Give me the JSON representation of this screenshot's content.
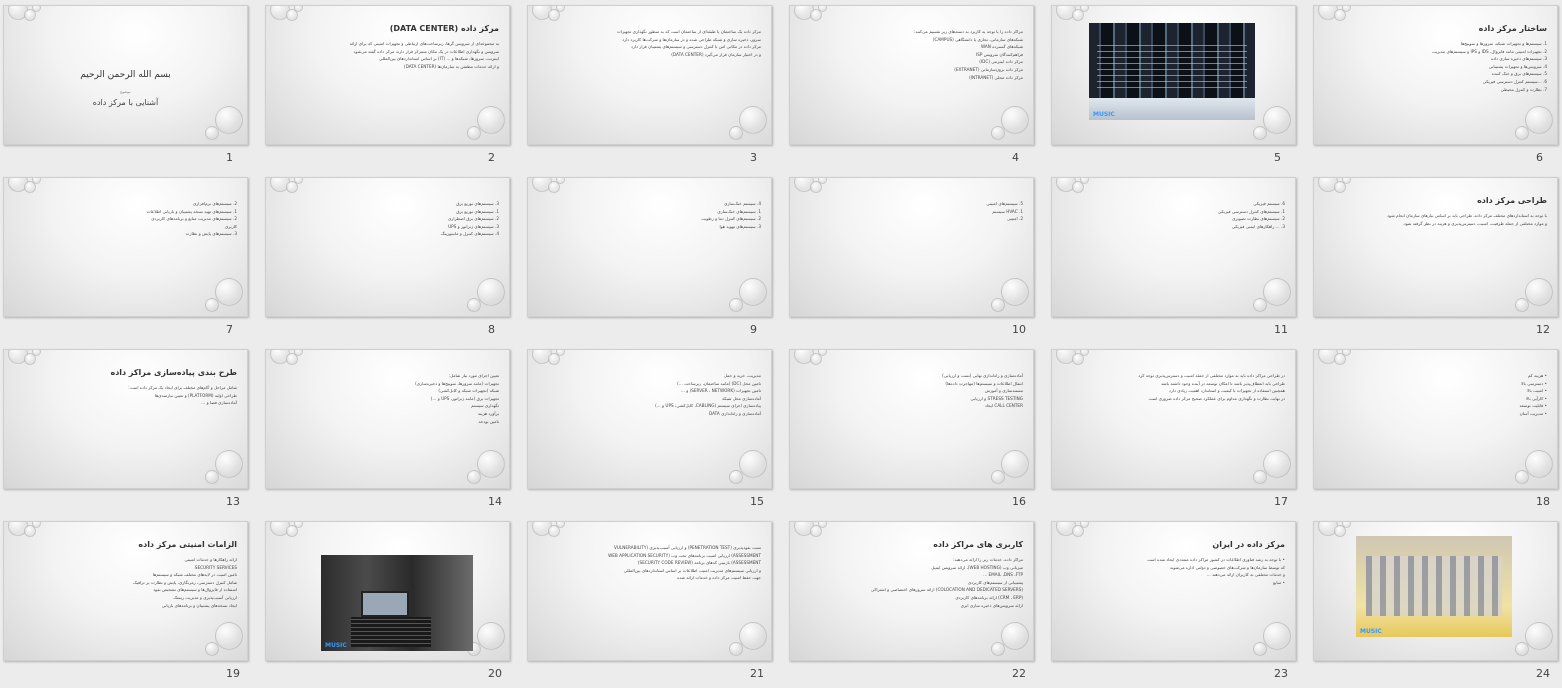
{
  "slides": [
    {
      "num": "1",
      "type": "title",
      "title": "بسم الله الرحمن الرحیم",
      "subtitle": "موضوع",
      "name": "آشنایی با مرکز داده"
    },
    {
      "num": "2",
      "type": "text",
      "title": "مرکز داده (DATA CENTER)",
      "lines": [
        "به مجموعه‌ای از سرویس گرها، زیرساخت‌های ارتباطی و تجهیزات امنیتی که برای ارائه",
        "سرویس و نگهداری اطلاعات در یک مکان متمرکز قرار دارند مرکز داده گفته می‌شود",
        "اینترنت، سرورها، شبکه‌ها و ... (IT) بر اساس استانداردهای بین‌المللی",
        "و ارائه خدمات مطمئن به سازمان‌ها (DATA CENTER)"
      ]
    },
    {
      "num": "3",
      "type": "text",
      "title": "",
      "lines": [
        "مرکز داده یک ساختمان یا طبقه‌ای از ساختمان است که به منظور نگهداری تجهیزات",
        "سرور، ذخیره سازی و شبکه طراحی شده و در سازمان‌ها و شرکت‌ها کاربرد دارد",
        "مرکز داده در مکانی امن با کنترل دسترسی و سیستم‌های پشتیبان قرار دارد",
        "و در اختیار سازمان قرار می‌گیرد (DATA CENTER)"
      ]
    },
    {
      "num": "4",
      "type": "text",
      "title": "",
      "lines": [
        "مراکز داده را با توجه به کاربرد به دسته‌های زیر تقسیم می‌کنند:",
        "شبکه‌های سازمانی، تجاری یا دانشگاهی (CAMPUS)",
        "شبکه‌های گسترده WAN",
        "فراهم‌کنندگان سرویس ISP",
        "مرکز داده اینترنتی (IDC)",
        "مرکز داده برون‌سازمانی (EXTRANET)",
        "مرکز داده محلی (INTRANET)"
      ]
    },
    {
      "num": "5",
      "type": "photo",
      "kind": "servers",
      "logo": "MUSIC"
    },
    {
      "num": "6",
      "type": "text",
      "title": "ساختار مرکز داده",
      "lines": [
        "1. سیستم‌ها و تجهیزات شبکه، سرورها و سوییچ‌ها",
        "2. تجهیزات امنیتی مانند فایروال، IDS و IPS و سیستم‌های مدیریت",
        "3. سیستم‌های ذخیره سازی داده",
        "4. سرویس‌ها و تجهیزات پشتیبانی",
        "5. سیستم‌های برق و خنک کننده",
        "6. ...سیستم کنترل دسترسی فیزیکی",
        "7. نظارت و کنترل محیطی"
      ]
    },
    {
      "num": "7",
      "type": "text",
      "title": "",
      "lines": [
        "2. سیستم‌های نرم‌افزاری",
        "1. سیستم‌های تهیه نسخه پشتیبان و بازیابی اطلاعات",
        "2. سیستم‌های مدیریت منابع و برنامه‌های کاربردی",
        "کاربری",
        "3. سیستم‌های پایش و نظارت"
      ]
    },
    {
      "num": "8",
      "type": "text",
      "title": "",
      "lines": [
        "3. سیستم‌های توزیع برق",
        "1. سیستم‌های توزیع برق",
        "2. سیستم‌های برق اضطراری",
        "3. سیستم‌های ژنراتور و UPS",
        "4. سیستم‌های کنترل و مانیتورینگ"
      ]
    },
    {
      "num": "9",
      "type": "text",
      "title": "",
      "lines": [
        "4. سیستم خنک‌سازی",
        "1. سیستم‌های خنک‌سازی",
        "2. سیستم‌های کنترل دما و رطوبت",
        "3. سیستم‌های تهویه هوا"
      ]
    },
    {
      "num": "10",
      "type": "text",
      "title": "",
      "lines": [
        "5. سیستم‌های امنیتی",
        "1. HVAC سیستم",
        "2. امنیتی"
      ]
    },
    {
      "num": "11",
      "type": "text",
      "title": "",
      "lines": [
        "6. سیستم فیزیکی",
        "1. سیستم‌های کنترل دسترسی فیزیکی",
        "2. سیستم‌های نظارت تصویری",
        "3. ... راهکارهای ایمنی فیزیکی"
      ]
    },
    {
      "num": "12",
      "type": "text",
      "title": "طراحی مرکز داده",
      "lines": [
        "با توجه به استانداردهای مختلف مرکز داده، طراحی باید بر اساس نیازهای سازمان انجام شود",
        "و موارد مختلفی از جمله ظرفیت، امنیت، دسترس‌پذیری و هزینه در نظر گرفته شود."
      ]
    },
    {
      "num": "13",
      "type": "text",
      "title": "طرح بندی پیاده‌سازی مراکز داده",
      "lines": [
        "شامل مراحل و گام‌های مختلف برای ایجاد یک مرکز داده است:",
        "طراحی اولیه (PLATFORM) و تعیین نیازمندی‌ها",
        "آماده‌سازی فضا و ..."
      ]
    },
    {
      "num": "14",
      "type": "text",
      "title": "",
      "lines": [
        "تعیین اجزای مورد نیاز شامل:",
        "تجهیزات (مانند سرورها، سوییچ‌ها و ذخیره‌سازی)",
        "شبکه (تجهیزات شبکه و کابل‌کشی)",
        "تجهیزات برق (مانند ژنراتور، UPS و ...)",
        "نگهداری سیستم",
        "برآورد هزینه",
        "تامین بودجه"
      ]
    },
    {
      "num": "15",
      "type": "text",
      "title": "",
      "lines": [
        "مدیریت، خرید و حمل",
        "تامین محل (DC) (مانند ساختمان، زیرساخت ...)",
        "تامین تجهیزات (SERVER ، NETWORK) و ...",
        "آماده‌سازی محل شبکه",
        "پیاده‌سازی اجزای سیستم (CABLING، کابل‌کشی، UPS و ...)",
        "آماده‌سازی و راه‌اندازی DATA"
      ]
    },
    {
      "num": "16",
      "type": "text",
      "title": "",
      "lines": [
        "آماده‌سازی و راه‌اندازی نهایی (تست و ارزیابی)",
        "انتقال اطلاعات و سیستم‌ها (مهاجرت داده‌ها)",
        "مستندسازی و آموزش",
        "STRESS TESTING و ارزیابی",
        "CALL CENTER ایجاد"
      ]
    },
    {
      "num": "17",
      "type": "text",
      "title": "",
      "lines": [
        "در طراحی مراکز داده باید به موارد مختلفی از جمله امنیت و دسترس‌پذیری توجه کرد",
        "طراحی باید انعطاف‌پذیر باشد تا امکان توسعه در آینده وجود داشته باشد",
        "همچنین استفاده از تجهیزات با کیفیت و استاندارد اهمیت زیادی دارد",
        "در نهایت نظارت و نگهداری مداوم برای عملکرد صحیح مرکز داده ضروری است"
      ]
    },
    {
      "num": "18",
      "type": "text",
      "title": "",
      "lines": [
        "• هزینه کم",
        "• دسترسی بالا",
        "• امنیت بالا",
        "• کارآیی بالا",
        "• قابلیت توسعه",
        "• مدیریت آسان"
      ]
    },
    {
      "num": "19",
      "type": "text",
      "title": "الزامات امنیتی مرکز داده",
      "lines": [
        "ارائه راهکارها و خدمات امنیتی",
        "SECURITY SERVICES",
        "تامین امنیت در لایه‌های مختلف شبکه و سیستم‌ها",
        "شامل کنترل دسترسی، رمزنگاری، پایش و نظارت بر ترافیک",
        "استفاده از فایروال‌ها و سیستم‌های تشخیص نفوذ",
        "ارزیابی آسیب‌پذیری و مدیریت ریسک",
        "ایجاد نسخه‌های پشتیبان و برنامه‌های بازیابی"
      ]
    },
    {
      "num": "20",
      "type": "photo",
      "kind": "rack",
      "logo": "MUSIC"
    },
    {
      "num": "21",
      "type": "text",
      "title": "",
      "lines": [
        "تست نفوذپذیری (PENETRATION TEST) و ارزیابی آسیب‌پذیری (VULNERABILITY",
        "ASSESSMENT) ارزیابی امنیت برنامه‌های تحت وب (WEB APPLICATION SECURITY",
        "ASSESSMENT) بازبینی کدهای برنامه (SECURITY CODE REVIEW)",
        "و ارزیابی سیستم‌های مدیریت امنیت اطلاعات بر اساس استانداردهای بین‌المللی",
        "جهت حفظ امنیت مرکز داده و خدمات ارائه شده"
      ]
    },
    {
      "num": "22",
      "type": "text",
      "title": "کاربری های مراکز داده",
      "lines": [
        "مراکز داده، خدمات زیر را ارائه می‌دهند:",
        "میزبانی وب (WEB HOSTING)، ارائه سرویس ایمیل",
        "EMAIL ،DNS ،FTP ...",
        "پشتیبانی از سیستم‌های کاربردی",
        "(COLOCATION AND DEDICATED SERVERS) ارائه سرورهای اختصاصی و اشتراکی",
        "(CRM ، ERP) ارائه برنامه‌های کاربردی",
        "ارائه سرویس‌های ذخیره سازی ابری"
      ]
    },
    {
      "num": "23",
      "type": "text",
      "title": "مرکز داده در ایران",
      "lines": [
        "• با توجه به رشد فناوری اطلاعات در کشور مراکز داده متعددی ایجاد شده است",
        "که توسط سازمان‌ها و شرکت‌های خصوصی و دولتی اداره می‌شوند",
        "و خدمات مختلفی به کاربران ارائه می‌دهند ...",
        "• منابع"
      ]
    },
    {
      "num": "24",
      "type": "photo",
      "kind": "batteries",
      "logo": "MUSIC"
    }
  ]
}
